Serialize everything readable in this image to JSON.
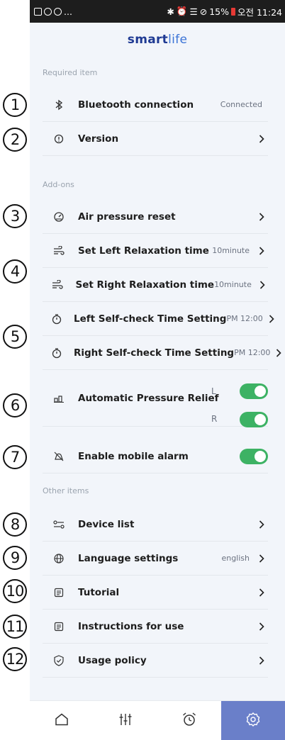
{
  "status_bar": {
    "left_text": "...",
    "battery": "15%",
    "carrier_time": "오전 11:24"
  },
  "header": {
    "logo_bold": "smart",
    "logo_light": "life"
  },
  "sections": {
    "required": "Required item",
    "addons": "Add-ons",
    "other": "Other items"
  },
  "rows": {
    "bluetooth": {
      "label": "Bluetooth connection",
      "value": "Connected"
    },
    "version": {
      "label": "Version"
    },
    "air_pressure": {
      "label": "Air pressure reset"
    },
    "left_relax": {
      "label": "Set Left Relaxation time",
      "value": "10minute"
    },
    "right_relax": {
      "label": "Set Right Relaxation time",
      "value": "10minute"
    },
    "left_check": {
      "label": "Left Self-check Time Setting",
      "value": "PM 12:00"
    },
    "right_check": {
      "label": "Right Self-check Time Setting",
      "value": "PM 12:00"
    },
    "auto_relief": {
      "label": "Automatic Pressure Relief",
      "left": "L",
      "right": "R",
      "left_on": true,
      "right_on": true
    },
    "mobile_alarm": {
      "label": "Enable mobile alarm",
      "on": true
    },
    "device_list": {
      "label": "Device list"
    },
    "language": {
      "label": "Language settings",
      "value": "english"
    },
    "tutorial": {
      "label": "Tutorial"
    },
    "instructions": {
      "label": "Instructions for use"
    },
    "policy": {
      "label": "Usage policy"
    }
  },
  "annotations": [
    "1",
    "2",
    "3",
    "4",
    "5",
    "6",
    "7",
    "8",
    "9",
    "10",
    "11",
    "12"
  ],
  "bottom_nav": {
    "items": [
      "home-icon",
      "equalizer-icon",
      "alarm-icon",
      "settings-icon"
    ],
    "active": "settings-icon",
    "active_color": "#6a7fc9"
  },
  "colors": {
    "toggle_on": "#3db264",
    "background": "#f2f5fa",
    "brand": "#1f3a93"
  }
}
